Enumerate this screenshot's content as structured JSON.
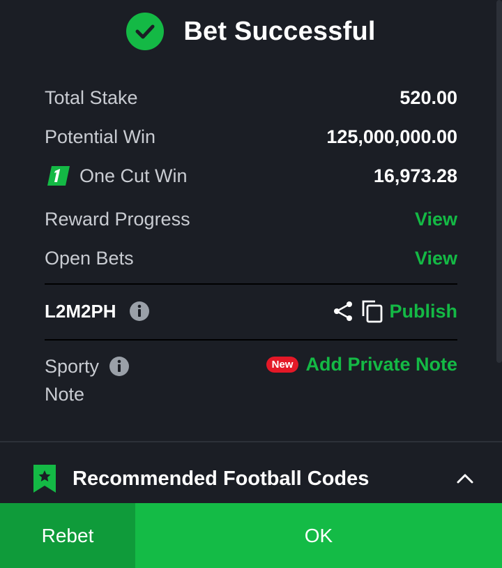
{
  "header": {
    "title": "Bet Successful"
  },
  "summary": [
    {
      "label": "Total Stake",
      "value": "520.00"
    },
    {
      "label": "Potential Win",
      "value": "125,000,000.00"
    },
    {
      "label": "One Cut Win",
      "value": "16,973.28"
    }
  ],
  "links": [
    {
      "label": "Reward Progress",
      "action": "View"
    },
    {
      "label": "Open Bets",
      "action": "View"
    }
  ],
  "booking": {
    "code": "L2M2PH",
    "publish_label": "Publish"
  },
  "note": {
    "label_line1": "Sporty",
    "label_line2": "Note",
    "badge": "New",
    "action": "Add Private Note"
  },
  "recommended": {
    "title": "Recommended Football Codes"
  },
  "buttons": {
    "rebet": "Rebet",
    "ok": "OK"
  },
  "colors": {
    "accent": "#14b945",
    "background": "#1b1e25",
    "badge": "#e41827"
  },
  "icons": [
    "check-circle-icon",
    "one-cut-icon",
    "info-icon",
    "share-icon",
    "copy-icon",
    "bookmark-star-icon",
    "chevron-up-icon"
  ]
}
